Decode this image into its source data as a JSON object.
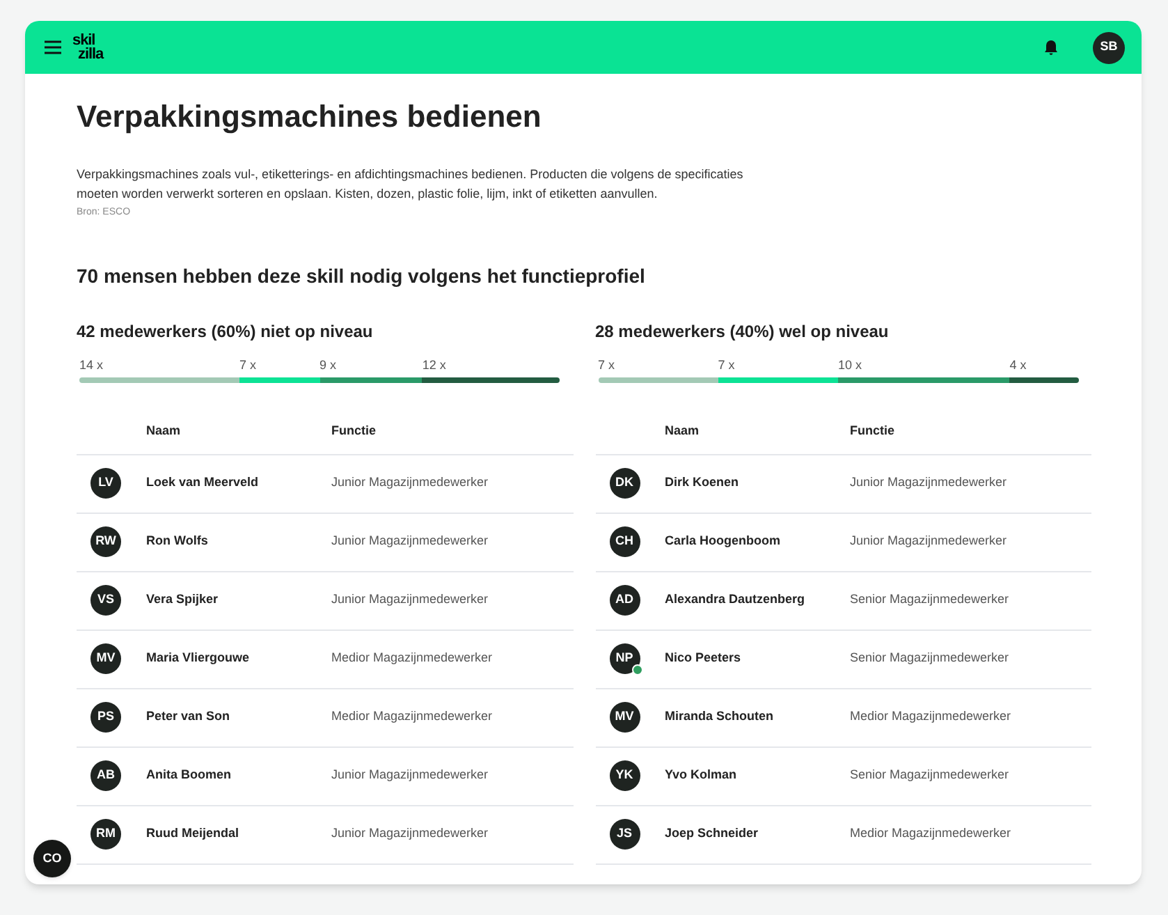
{
  "header": {
    "logo": [
      "skil",
      "zilla"
    ],
    "avatar": "SB"
  },
  "title": "Verpakkingsmachines bedienen",
  "description": "Verpakkingsmachines zoals vul-, etiketterings- en afdichtingsmachines bedienen. Producten die volgens de specificaties moeten worden verwerkt sorteren en opslaan. Kisten, dozen, plastic folie, lijm, inkt of etiketten aanvullen.",
  "source": "Bron: ESCO",
  "summary": "70 mensen hebben deze skill nodig volgens het functieprofiel",
  "groups": [
    {
      "heading": "42 medewerkers (60%) niet op niveau",
      "segments": [
        {
          "count": "14",
          "unit": "x",
          "color": "#a3c9b5"
        },
        {
          "count": "7",
          "unit": "x",
          "color": "#0de295"
        },
        {
          "count": "9",
          "unit": "x",
          "color": "#2a9a68"
        },
        {
          "count": "12",
          "unit": "x",
          "color": "#235c41"
        }
      ],
      "columns": [
        "Naam",
        "Functie"
      ],
      "rows": [
        {
          "initials": "LV",
          "name": "Loek van Meerveld",
          "function": "Junior Magazijnmedewerker",
          "verified": false
        },
        {
          "initials": "RW",
          "name": "Ron Wolfs",
          "function": "Junior Magazijnmedewerker",
          "verified": false
        },
        {
          "initials": "VS",
          "name": "Vera Spijker",
          "function": "Junior Magazijnmedewerker",
          "verified": false
        },
        {
          "initials": "MV",
          "name": "Maria Vliergouwe",
          "function": "Medior Magazijnmedewerker",
          "verified": false
        },
        {
          "initials": "PS",
          "name": "Peter van Son",
          "function": "Medior Magazijnmedewerker",
          "verified": false
        },
        {
          "initials": "AB",
          "name": "Anita Boomen",
          "function": "Junior Magazijnmedewerker",
          "verified": false
        },
        {
          "initials": "RM",
          "name": "Ruud Meijendal",
          "function": "Junior Magazijnmedewerker",
          "verified": false
        }
      ]
    },
    {
      "heading": "28 medewerkers (40%) wel op niveau",
      "segments": [
        {
          "count": "7",
          "unit": "x",
          "color": "#a3c9b5"
        },
        {
          "count": "7",
          "unit": "x",
          "color": "#0de295"
        },
        {
          "count": "10",
          "unit": "x",
          "color": "#2a9a68"
        },
        {
          "count": "4",
          "unit": "x",
          "color": "#235c41"
        }
      ],
      "columns": [
        "Naam",
        "Functie"
      ],
      "rows": [
        {
          "initials": "DK",
          "name": "Dirk Koenen",
          "function": "Junior Magazijnmedewerker",
          "verified": false
        },
        {
          "initials": "CH",
          "name": "Carla Hoogenboom",
          "function": "Junior Magazijnmedewerker",
          "verified": false
        },
        {
          "initials": "AD",
          "name": "Alexandra Dautzenberg",
          "function": "Senior Magazijnmedewerker",
          "verified": false
        },
        {
          "initials": "NP",
          "name": "Nico Peeters",
          "function": "Senior Magazijnmedewerker",
          "verified": true
        },
        {
          "initials": "MV",
          "name": "Miranda Schouten",
          "function": "Medior Magazijnmedewerker",
          "verified": false
        },
        {
          "initials": "YK",
          "name": "Yvo Kolman",
          "function": "Senior Magazijnmedewerker",
          "verified": false
        },
        {
          "initials": "JS",
          "name": "Joep Schneider",
          "function": "Medior Magazijnmedewerker",
          "verified": false
        }
      ]
    }
  ],
  "chat_button": "CO"
}
